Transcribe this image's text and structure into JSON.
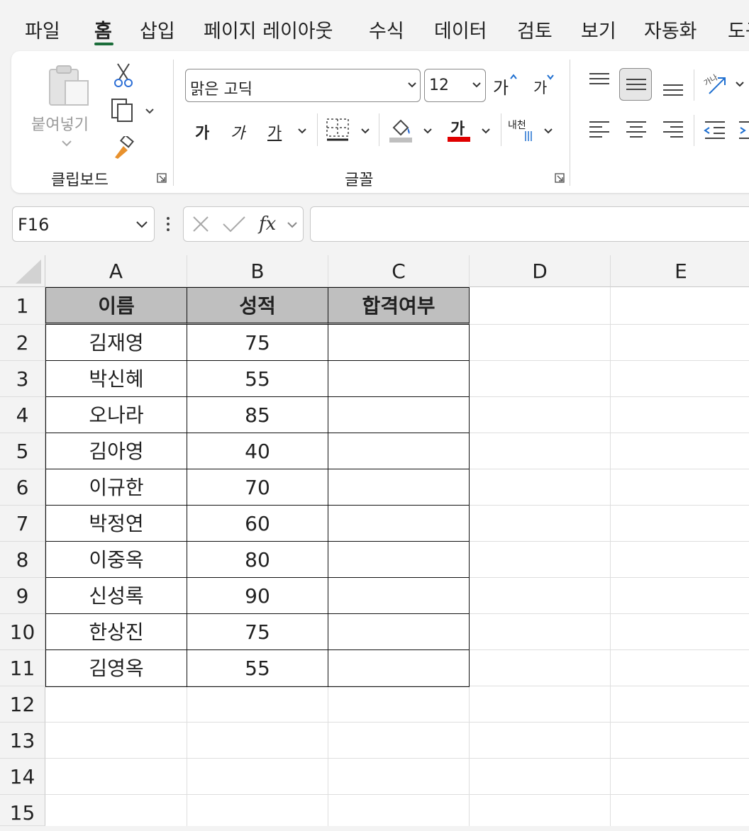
{
  "tabs": [
    "파일",
    "홈",
    "삽입",
    "페이지 레이아웃",
    "수식",
    "데이터",
    "검토",
    "보기",
    "자동화",
    "도구"
  ],
  "active_tab": "홈",
  "ribbon": {
    "clipboard": {
      "paste_label": "붙여넣기",
      "group_label": "클립보드"
    },
    "font": {
      "font_name": "맑은 고딕",
      "font_size": "12",
      "grow_label": "가",
      "shrink_label": "가",
      "bold_label": "가",
      "italic_label": "가",
      "underline_label": "가",
      "font_color_label": "가",
      "phonetic_label": "내천",
      "group_label": "글꼴"
    },
    "colors": {
      "fill": "#bfbfbf",
      "font": "#e00000",
      "accent": "#1b6d3a"
    }
  },
  "formula_bar": {
    "name_box": "F16",
    "formula": ""
  },
  "sheet": {
    "columns": [
      "A",
      "B",
      "C",
      "D",
      "E"
    ],
    "rows": [
      "1",
      "2",
      "3",
      "4",
      "5",
      "6",
      "7",
      "8",
      "9",
      "10",
      "11",
      "12",
      "13",
      "14",
      "15"
    ],
    "header": [
      "이름",
      "성적",
      "합격여부"
    ],
    "data": [
      [
        "김재영",
        "75",
        ""
      ],
      [
        "박신혜",
        "55",
        ""
      ],
      [
        "오나라",
        "85",
        ""
      ],
      [
        "김아영",
        "40",
        ""
      ],
      [
        "이규한",
        "70",
        ""
      ],
      [
        "박정연",
        "60",
        ""
      ],
      [
        "이중옥",
        "80",
        ""
      ],
      [
        "신성록",
        "90",
        ""
      ],
      [
        "한상진",
        "75",
        ""
      ],
      [
        "김영옥",
        "55",
        ""
      ]
    ]
  }
}
